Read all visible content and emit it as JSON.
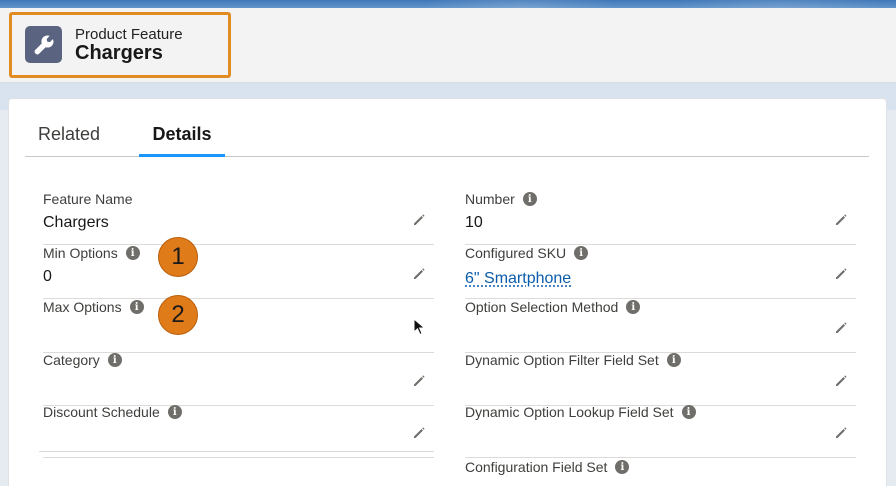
{
  "header": {
    "object_label": "Product Feature",
    "record_title": "Chargers",
    "icon": "wrench-icon"
  },
  "tabs": [
    {
      "label": "Related",
      "active": false
    },
    {
      "label": "Details",
      "active": true
    }
  ],
  "fields_left": [
    {
      "label": "Feature Name",
      "value": "Chargers",
      "info": false
    },
    {
      "label": "Min Options",
      "value": "0",
      "info": true
    },
    {
      "label": "Max Options",
      "value": "",
      "info": true
    },
    {
      "label": "Category",
      "value": "",
      "info": true
    },
    {
      "label": "Discount Schedule",
      "value": "",
      "info": true
    }
  ],
  "fields_right": [
    {
      "label": "Number",
      "value": "10",
      "info": true
    },
    {
      "label": "Configured SKU",
      "value": "6\" Smartphone",
      "info": true,
      "link": true
    },
    {
      "label": "Option Selection Method",
      "value": "",
      "info": true
    },
    {
      "label": "Dynamic Option Filter Field Set",
      "value": "",
      "info": true
    },
    {
      "label": "Dynamic Option Lookup Field Set",
      "value": "",
      "info": true
    },
    {
      "label": "Configuration Field Set",
      "value": "",
      "info": true
    }
  ],
  "annotations": {
    "badge_1": "1",
    "badge_2": "2"
  },
  "colors": {
    "highlight": "#e08c22",
    "badge": "#e07b1a",
    "tab_active": "#1b96ff",
    "link": "#0b5cab",
    "icon_bg": "#5a6380"
  }
}
